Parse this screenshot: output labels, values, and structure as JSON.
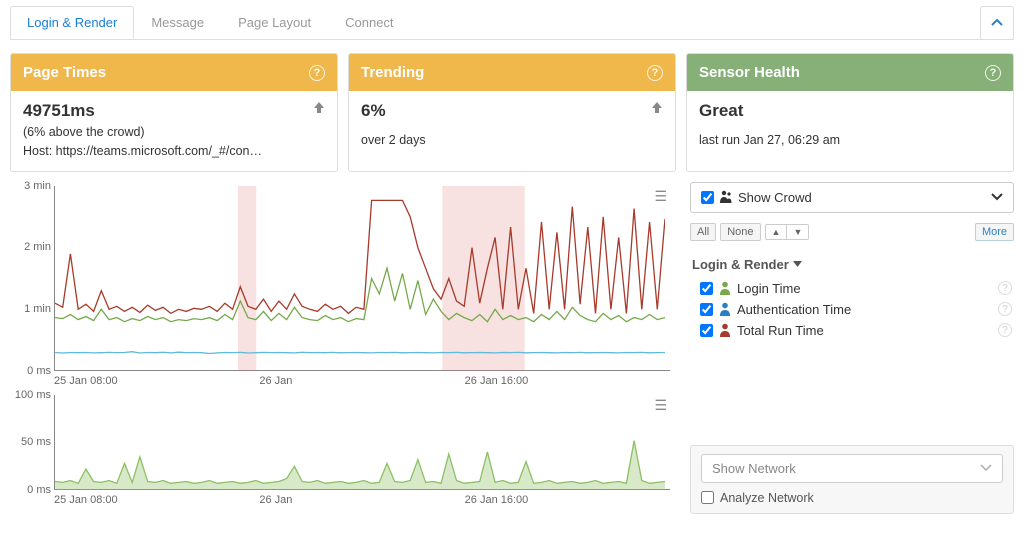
{
  "tabs": {
    "items": [
      "Login & Render",
      "Message",
      "Page Layout",
      "Connect"
    ],
    "active": 0
  },
  "cards": {
    "page_times": {
      "title": "Page Times",
      "metric": "49751ms",
      "sub1": "(6% above the crowd)",
      "sub2": "Host: https://teams.microsoft.com/_#/con…"
    },
    "trending": {
      "title": "Trending",
      "metric": "6%",
      "sub1": "over 2 days"
    },
    "sensor": {
      "title": "Sensor Health",
      "metric": "Great",
      "sub1": "last run Jan 27, 06:29 am"
    }
  },
  "side": {
    "show_crowd": "Show Crowd",
    "btn_all": "All",
    "btn_none": "None",
    "btn_more": "More",
    "group_title": "Login & Render",
    "items": [
      {
        "label": "Login Time",
        "color": "#77a94b"
      },
      {
        "label": "Authentication Time",
        "color": "#2b7fc3"
      },
      {
        "label": "Total Run Time",
        "color": "#a73a2a"
      }
    ]
  },
  "network": {
    "show_label": "Show Network",
    "analyze_label": "Analyze Network"
  },
  "chart_data": [
    {
      "type": "line",
      "title": "",
      "xlabel": "",
      "ylabel": "",
      "y_unit": "ms",
      "ylim": [
        0,
        180000
      ],
      "y_ticks": [
        {
          "v": 0,
          "l": "0 ms"
        },
        {
          "v": 60000,
          "l": "1 min"
        },
        {
          "v": 120000,
          "l": "2 min"
        },
        {
          "v": 180000,
          "l": "3 min"
        }
      ],
      "x_ticks": [
        "25 Jan 08:00",
        "26 Jan",
        "26 Jan 16:00"
      ],
      "highlight_bands_x": [
        [
          0.3,
          0.33
        ],
        [
          0.635,
          0.77
        ]
      ],
      "series": [
        {
          "name": "Authentication Time",
          "color": "#5fb9d8",
          "values": [
            18000,
            17500,
            18000,
            17800,
            18000,
            17600,
            17800,
            18100,
            17900,
            18000,
            18800,
            17500,
            18000,
            17800,
            18200,
            17600,
            18300,
            17900,
            18000,
            17800,
            17000,
            17600,
            18000,
            17900,
            18100,
            17500,
            17800,
            18050,
            17900,
            18000,
            17800,
            17600,
            18200,
            17900,
            18000,
            17800,
            18100,
            17700,
            17900,
            18000,
            17800,
            17600,
            18000,
            17900,
            18100,
            17700,
            17900,
            18000,
            17800,
            17600,
            18000,
            17900,
            18100,
            17700,
            17900,
            18000,
            17800,
            17600,
            18000,
            17900,
            18100,
            17700,
            17900,
            18000,
            17800,
            17600,
            18000,
            17900,
            18100,
            17700,
            17900,
            18000,
            17800,
            17600,
            18000,
            17900,
            18100,
            17700,
            17900,
            18000
          ]
        },
        {
          "name": "Login Time",
          "color": "#77a94b",
          "values": [
            52000,
            51000,
            55000,
            50000,
            53000,
            49000,
            60000,
            50000,
            52000,
            48000,
            51000,
            49000,
            53000,
            50000,
            52000,
            48000,
            50000,
            49000,
            51000,
            50000,
            52000,
            49000,
            55000,
            50000,
            68000,
            52000,
            50000,
            58000,
            49000,
            56000,
            50000,
            62000,
            52000,
            50000,
            49000,
            54000,
            50000,
            52000,
            48000,
            51000,
            50000,
            90000,
            75000,
            100000,
            68000,
            95000,
            60000,
            88000,
            55000,
            70000,
            58000,
            50000,
            56000,
            52000,
            49000,
            55000,
            48000,
            60000,
            50000,
            54000,
            50000,
            52000,
            48000,
            55000,
            50000,
            58000,
            50000,
            62000,
            54000,
            50000,
            48000,
            56000,
            50000,
            54000,
            48000,
            52000,
            50000,
            55000,
            50000,
            52000
          ]
        },
        {
          "name": "Total Run Time",
          "color": "#a73a2a",
          "values": [
            66000,
            62000,
            114000,
            60000,
            65000,
            58000,
            78000,
            60000,
            63000,
            58000,
            62000,
            57000,
            64000,
            59000,
            62000,
            56000,
            60000,
            58000,
            61000,
            60000,
            63000,
            58000,
            66000,
            60000,
            82000,
            63000,
            60000,
            70000,
            58000,
            68000,
            60000,
            75000,
            63000,
            60000,
            58000,
            65000,
            60000,
            63000,
            56000,
            62000,
            60000,
            166000,
            166000,
            166000,
            166000,
            166000,
            150000,
            120000,
            100000,
            80000,
            70000,
            90000,
            68000,
            63000,
            120000,
            66000,
            100000,
            130000,
            60000,
            140000,
            60000,
            100000,
            56000,
            145000,
            60000,
            135000,
            60000,
            160000,
            65000,
            140000,
            56000,
            150000,
            60000,
            130000,
            56000,
            158000,
            60000,
            145000,
            60000,
            148000
          ]
        }
      ]
    },
    {
      "type": "area",
      "title": "",
      "xlabel": "",
      "ylabel": "",
      "y_unit": "ms",
      "ylim": [
        0,
        100
      ],
      "y_ticks": [
        {
          "v": 0,
          "l": "0 ms"
        },
        {
          "v": 50,
          "l": "50 ms"
        },
        {
          "v": 100,
          "l": "100 ms"
        }
      ],
      "x_ticks": [
        "25 Jan 08:00",
        "26 Jan",
        "26 Jan 16:00"
      ],
      "series": [
        {
          "name": "Network",
          "color": "#8cc063",
          "values": [
            9,
            8,
            10,
            7,
            22,
            9,
            8,
            10,
            7,
            28,
            8,
            35,
            9,
            8,
            10,
            7,
            8,
            9,
            7,
            8,
            10,
            7,
            8,
            9,
            7,
            8,
            10,
            7,
            8,
            9,
            12,
            25,
            9,
            8,
            10,
            7,
            8,
            9,
            7,
            8,
            10,
            7,
            8,
            28,
            9,
            8,
            10,
            32,
            8,
            9,
            7,
            38,
            10,
            7,
            8,
            9,
            40,
            8,
            10,
            7,
            8,
            30,
            7,
            8,
            10,
            7,
            8,
            9,
            7,
            8,
            10,
            7,
            8,
            9,
            7,
            52,
            10,
            7,
            8,
            9
          ]
        }
      ]
    }
  ]
}
